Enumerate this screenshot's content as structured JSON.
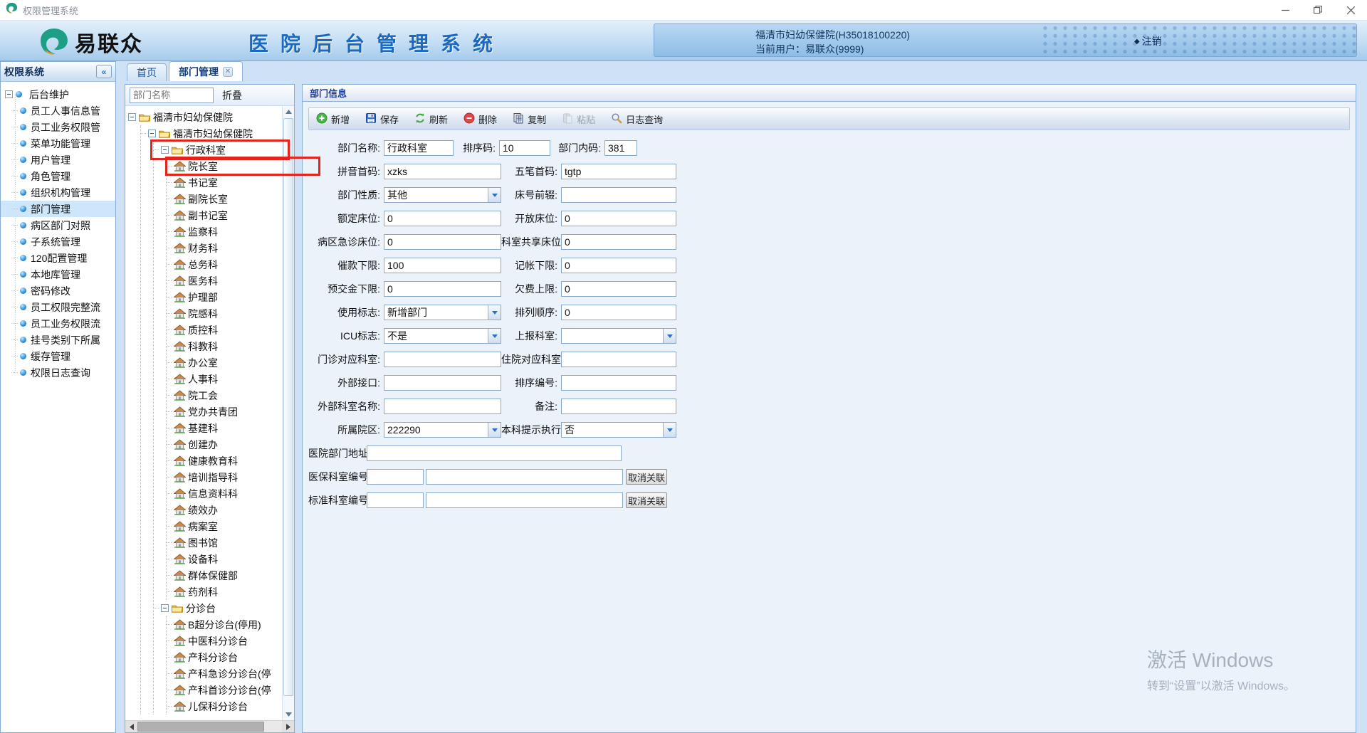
{
  "window": {
    "title": "权限管理系统"
  },
  "header": {
    "logo_text": "易联众",
    "app_title": "医院后台管理系统",
    "hospital": "福清市妇幼保健院(H35018100220)",
    "current_user": "当前用户：易联众(9999)",
    "logout_label": "注销"
  },
  "sidebar": {
    "title": "权限系统",
    "collapse_icon": "«",
    "root_label": "后台维护",
    "items": [
      {
        "label": "员工人事信息管"
      },
      {
        "label": "员工业务权限管"
      },
      {
        "label": "菜单功能管理"
      },
      {
        "label": "用户管理"
      },
      {
        "label": "角色管理"
      },
      {
        "label": "组织机构管理"
      },
      {
        "label": "部门管理",
        "selected": true
      },
      {
        "label": "病区部门对照"
      },
      {
        "label": "子系统管理"
      },
      {
        "label": "120配置管理"
      },
      {
        "label": "本地库管理"
      },
      {
        "label": "密码修改"
      },
      {
        "label": "员工权限完整流"
      },
      {
        "label": "员工业务权限流"
      },
      {
        "label": "挂号类别下所属"
      },
      {
        "label": "缓存管理"
      },
      {
        "label": "权限日志查询"
      }
    ]
  },
  "tabs": [
    {
      "label": "首页"
    },
    {
      "label": "部门管理",
      "active": true,
      "closable": true
    }
  ],
  "tree_panel": {
    "search_placeholder": "部门名称",
    "collapse_label": "折叠",
    "tree": [
      {
        "label": "福清市妇幼保健院",
        "children": [
          {
            "label": "福清市妇幼保健院",
            "children": [
              {
                "label": "行政科室",
                "highlight": true,
                "children": [
                  {
                    "label": "院长室",
                    "highlight": true
                  },
                  {
                    "label": "书记室"
                  },
                  {
                    "label": "副院长室"
                  },
                  {
                    "label": "副书记室"
                  },
                  {
                    "label": "监察科"
                  },
                  {
                    "label": "财务科"
                  },
                  {
                    "label": "总务科"
                  },
                  {
                    "label": "医务科"
                  },
                  {
                    "label": "护理部"
                  },
                  {
                    "label": "院感科"
                  },
                  {
                    "label": "质控科"
                  },
                  {
                    "label": "科教科"
                  },
                  {
                    "label": "办公室"
                  },
                  {
                    "label": "人事科"
                  },
                  {
                    "label": "院工会"
                  },
                  {
                    "label": "党办共青团"
                  },
                  {
                    "label": "基建科"
                  },
                  {
                    "label": "创建办"
                  },
                  {
                    "label": "健康教育科"
                  },
                  {
                    "label": "培训指导科"
                  },
                  {
                    "label": "信息资料科"
                  },
                  {
                    "label": "绩效办"
                  },
                  {
                    "label": "病案室"
                  },
                  {
                    "label": "图书馆"
                  },
                  {
                    "label": "设备科"
                  },
                  {
                    "label": "群体保健部"
                  },
                  {
                    "label": "药剂科"
                  }
                ]
              },
              {
                "label": "分诊台",
                "children": [
                  {
                    "label": "B超分诊台(停用)"
                  },
                  {
                    "label": "中医科分诊台"
                  },
                  {
                    "label": "产科分诊台"
                  },
                  {
                    "label": "产科急诊分诊台(停"
                  },
                  {
                    "label": "产科首诊分诊台(停"
                  },
                  {
                    "label": "儿保科分诊台"
                  }
                ]
              }
            ]
          }
        ]
      }
    ]
  },
  "form": {
    "panel_title": "部门信息",
    "toolbar": [
      {
        "label": "新增",
        "icon": "add"
      },
      {
        "label": "保存",
        "icon": "save"
      },
      {
        "label": "刷新",
        "icon": "refresh"
      },
      {
        "label": "删除",
        "icon": "delete"
      },
      {
        "label": "复制",
        "icon": "copy"
      },
      {
        "label": "粘贴",
        "icon": "paste",
        "disabled": true
      },
      {
        "label": "日志查询",
        "icon": "log-search"
      }
    ],
    "rows": [
      {
        "cols": [
          {
            "label": "部门名称:",
            "value": "行政科室"
          },
          {
            "label": "排序码:",
            "value": "10"
          },
          {
            "label": "部门内码:",
            "value": "381"
          }
        ]
      },
      {
        "cols": [
          {
            "label": "拼音首码:",
            "value": "xzks"
          },
          {
            "label": "五笔首码:",
            "value": "tgtp"
          }
        ]
      },
      {
        "cols": [
          {
            "label": "部门性质:",
            "value": "其他",
            "type": "select"
          },
          {
            "label": "床号前辍:",
            "value": ""
          }
        ]
      },
      {
        "cols": [
          {
            "label": "额定床位:",
            "value": "0"
          },
          {
            "label": "开放床位:",
            "value": "0"
          }
        ]
      },
      {
        "cols": [
          {
            "label": "病区急诊床位:",
            "value": "0"
          },
          {
            "label": "科室共享床位:",
            "value": "0"
          }
        ]
      },
      {
        "cols": [
          {
            "label": "催款下限:",
            "value": "100"
          },
          {
            "label": "记帐下限:",
            "value": "0"
          }
        ]
      },
      {
        "cols": [
          {
            "label": "预交金下限:",
            "value": "0"
          },
          {
            "label": "欠费上限:",
            "value": "0"
          }
        ]
      },
      {
        "cols": [
          {
            "label": "使用标志:",
            "value": "新增部门",
            "type": "select"
          },
          {
            "label": "排列顺序:",
            "value": "0"
          }
        ]
      },
      {
        "cols": [
          {
            "label": "ICU标志:",
            "value": "不是",
            "type": "select"
          },
          {
            "label": "上报科室:",
            "value": "",
            "type": "select"
          }
        ]
      },
      {
        "cols": [
          {
            "label": "门诊对应科室:",
            "value": ""
          },
          {
            "label": "住院对应科室:",
            "value": ""
          }
        ]
      },
      {
        "cols": [
          {
            "label": "外部接口:",
            "value": ""
          },
          {
            "label": "排序编号:",
            "value": ""
          }
        ]
      },
      {
        "cols": [
          {
            "label": "外部科室名称:",
            "value": ""
          },
          {
            "label": "备注:",
            "value": ""
          }
        ]
      },
      {
        "cols": [
          {
            "label": "所属院区:",
            "value": "222290",
            "type": "select"
          },
          {
            "label": "本科提示执行:",
            "value": "否",
            "type": "select"
          }
        ]
      }
    ],
    "address_row": {
      "label": "医院部门地址：",
      "value": ""
    },
    "link_rows": [
      {
        "label": "医保科室编号:",
        "code": "",
        "name": "",
        "button": "取消关联"
      },
      {
        "label": "标准科室编号:",
        "code": "",
        "name": "",
        "button": "取消关联"
      }
    ]
  },
  "watermark": {
    "line1": "激活 Windows",
    "line2": "转到“设置”以激活 Windows。"
  }
}
